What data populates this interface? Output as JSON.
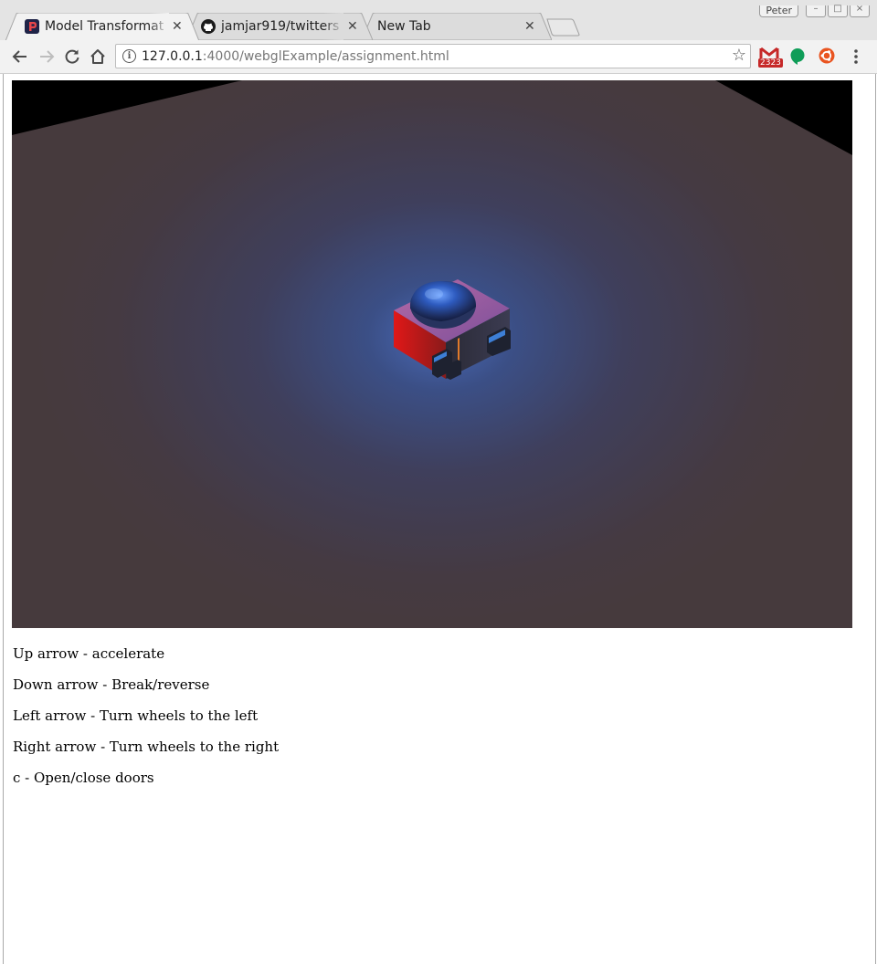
{
  "window": {
    "profile_name": "Peter"
  },
  "tabs": [
    {
      "title": "Model Transformat",
      "favicon": "p-logo-icon",
      "active": true
    },
    {
      "title": "jamjar919/twitters",
      "favicon": "github-icon",
      "active": false
    },
    {
      "title": "New Tab",
      "favicon": "",
      "active": false
    }
  ],
  "toolbar": {
    "url_host": "127.0.0.1",
    "url_path": ":4000/webglExample/assignment.html",
    "extensions": [
      {
        "name": "gmail-checker-icon",
        "badge": "2323"
      },
      {
        "name": "hangouts-icon"
      },
      {
        "name": "ubuntu-icon"
      }
    ]
  },
  "instructions": [
    "Up arrow - accelerate",
    "Down arrow - Break/reverse",
    "Left arrow - Turn wheels to the left",
    "Right arrow - Turn wheels to the right",
    "c - Open/close doors"
  ],
  "colors": {
    "floor": "#463a3d",
    "floor_glow": "#3f5aa0",
    "canvas_bg": "#000000"
  }
}
